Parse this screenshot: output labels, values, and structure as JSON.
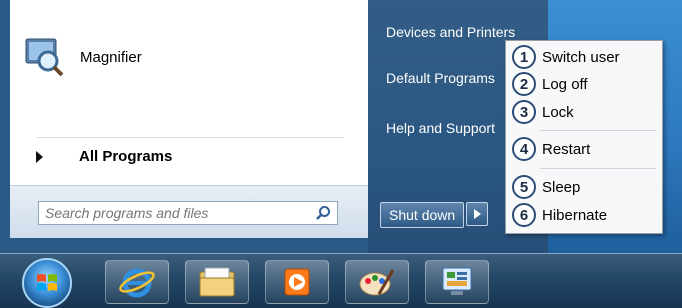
{
  "left_panel": {
    "pinned_app": "Magnifier",
    "all_programs": "All Programs"
  },
  "search": {
    "placeholder": "Search programs and files"
  },
  "right_panel": {
    "links": [
      "Devices and Printers",
      "Default Programs",
      "Help and Support"
    ],
    "shutdown_label": "Shut down"
  },
  "popup": {
    "items": [
      {
        "num": "1",
        "label": "Switch user"
      },
      {
        "num": "2",
        "label": "Log off"
      },
      {
        "num": "3",
        "label": "Lock"
      },
      {
        "num": "4",
        "label": "Restart"
      },
      {
        "num": "5",
        "label": "Sleep"
      },
      {
        "num": "6",
        "label": "Hibernate"
      }
    ]
  },
  "taskbar": {
    "icons": [
      "internet-explorer-icon",
      "file-explorer-icon",
      "media-player-icon",
      "paint-icon",
      "control-panel-icon"
    ]
  },
  "colors": {
    "start_menu_blue": "#2a5782",
    "accent": "#2b4d77"
  }
}
